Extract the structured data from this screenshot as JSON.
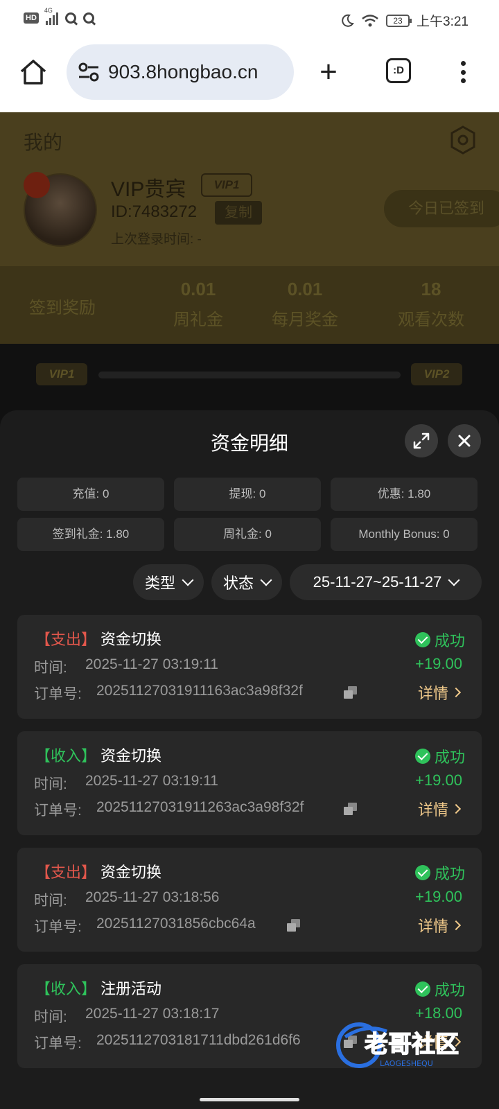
{
  "status_bar": {
    "hd": "HD",
    "network": "4G",
    "battery": "23",
    "time": "上午3:21"
  },
  "browser": {
    "url": "903.8hongbao.cn",
    "tabs_label": ":D"
  },
  "page": {
    "title": "我的",
    "vip_name": "VIP贵宾",
    "vip_level": "VIP1",
    "user_id": "ID:7483272",
    "copy_label": "复制",
    "last_login": "上次登录时间: -",
    "signed_label": "今日已签到",
    "stats": {
      "signin_label": "签到奖励",
      "weekly_value": "0.01",
      "weekly_label": "周礼金",
      "monthly_value": "0.01",
      "monthly_label": "每月奖金",
      "views_value": "18",
      "views_label": "观看次数"
    },
    "vip_current": "VIP1",
    "vip_next": "VIP2"
  },
  "sheet": {
    "title": "资金明细",
    "summary": [
      "充值: 0",
      "提现: 0",
      "优惠: 1.80",
      "签到礼金: 1.80",
      "周礼金: 0",
      "Monthly Bonus: 0"
    ],
    "filters": {
      "type": "类型",
      "status": "状态",
      "date_range": "25-11-27~25-11-27"
    },
    "records": [
      {
        "type": "【支出】",
        "title": "资金切换",
        "time_label": "时间:",
        "time": "2025-11-27 03:19:11",
        "order_label": "订单号:",
        "order": "20251127031911163ac3a98f32f",
        "status": "成功",
        "amount": "+19.00",
        "detail": "详情"
      },
      {
        "type": "【收入】",
        "title": "资金切换",
        "time_label": "时间:",
        "time": "2025-11-27 03:19:11",
        "order_label": "订单号:",
        "order": "20251127031911263ac3a98f32f",
        "status": "成功",
        "amount": "+19.00",
        "detail": "详情"
      },
      {
        "type": "【支出】",
        "title": "资金切换",
        "time_label": "时间:",
        "time": "2025-11-27 03:18:56",
        "order_label": "订单号:",
        "order": "20251127031856cbc64a",
        "status": "成功",
        "amount": "+19.00",
        "detail": "详情"
      },
      {
        "type": "【收入】",
        "title": "注册活动",
        "time_label": "时间:",
        "time": "2025-11-27 03:18:17",
        "order_label": "订单号:",
        "order": "2025112703181711dbd261d6f6",
        "status": "成功",
        "amount": "+18.00",
        "detail": "详情"
      }
    ]
  },
  "watermark": {
    "text": "老哥社区",
    "subtext": "LAOGESHEQU"
  },
  "colors": {
    "expense": "#e2574c",
    "income": "#2fc25b",
    "detail": "#f0c98a"
  }
}
